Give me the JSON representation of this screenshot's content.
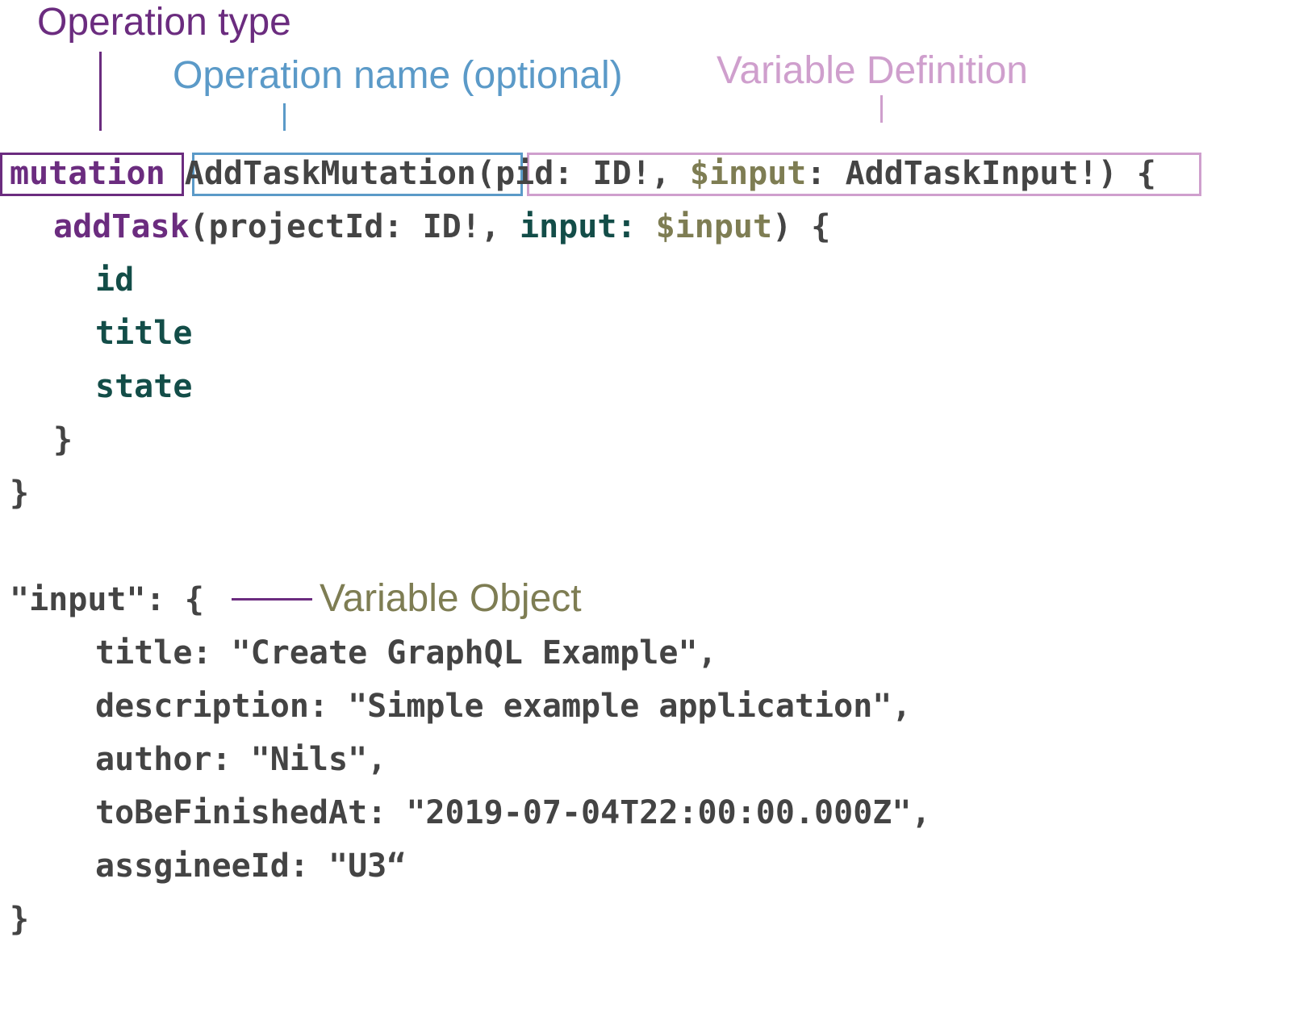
{
  "annotations": {
    "operation_type": "Operation type",
    "operation_name": "Operation name (optional)",
    "variable_definition": "Variable Definition",
    "variable_object": "Variable Object"
  },
  "colors": {
    "operation_type": "#6b2c7f",
    "operation_name": "#5b9ac8",
    "variable_definition": "#cf9fcd",
    "variable_object": "#7e7d53",
    "field": "#134d48",
    "plain": "#444444"
  },
  "query": {
    "keyword": "mutation",
    "name": "AddTaskMutation",
    "var_open": "(pid: ID!, ",
    "var_dollar_input": "$input",
    "var_colon": ": ",
    "var_type": "AddTaskInput!",
    "var_close": ") {",
    "field_name": "addTask",
    "field_args_open": "(projectId: ID!, ",
    "arg_name": "input:",
    "arg_space": " ",
    "arg_value": "$input",
    "field_args_close": ") {",
    "sub_id": "id",
    "sub_title": "title",
    "sub_state": "state",
    "inner_close": "}",
    "outer_close": "}"
  },
  "variables": {
    "open": "\"input\": {",
    "line1": "title: \"Create GraphQL Example\",",
    "line2": "description: \"Simple example application\",",
    "line3": "author: \"Nils\",",
    "line4": "toBeFinishedAt: \"2019-07-04T22:00:00.000Z\",",
    "line5": "assgineeId: \"U3“",
    "close": "}"
  }
}
